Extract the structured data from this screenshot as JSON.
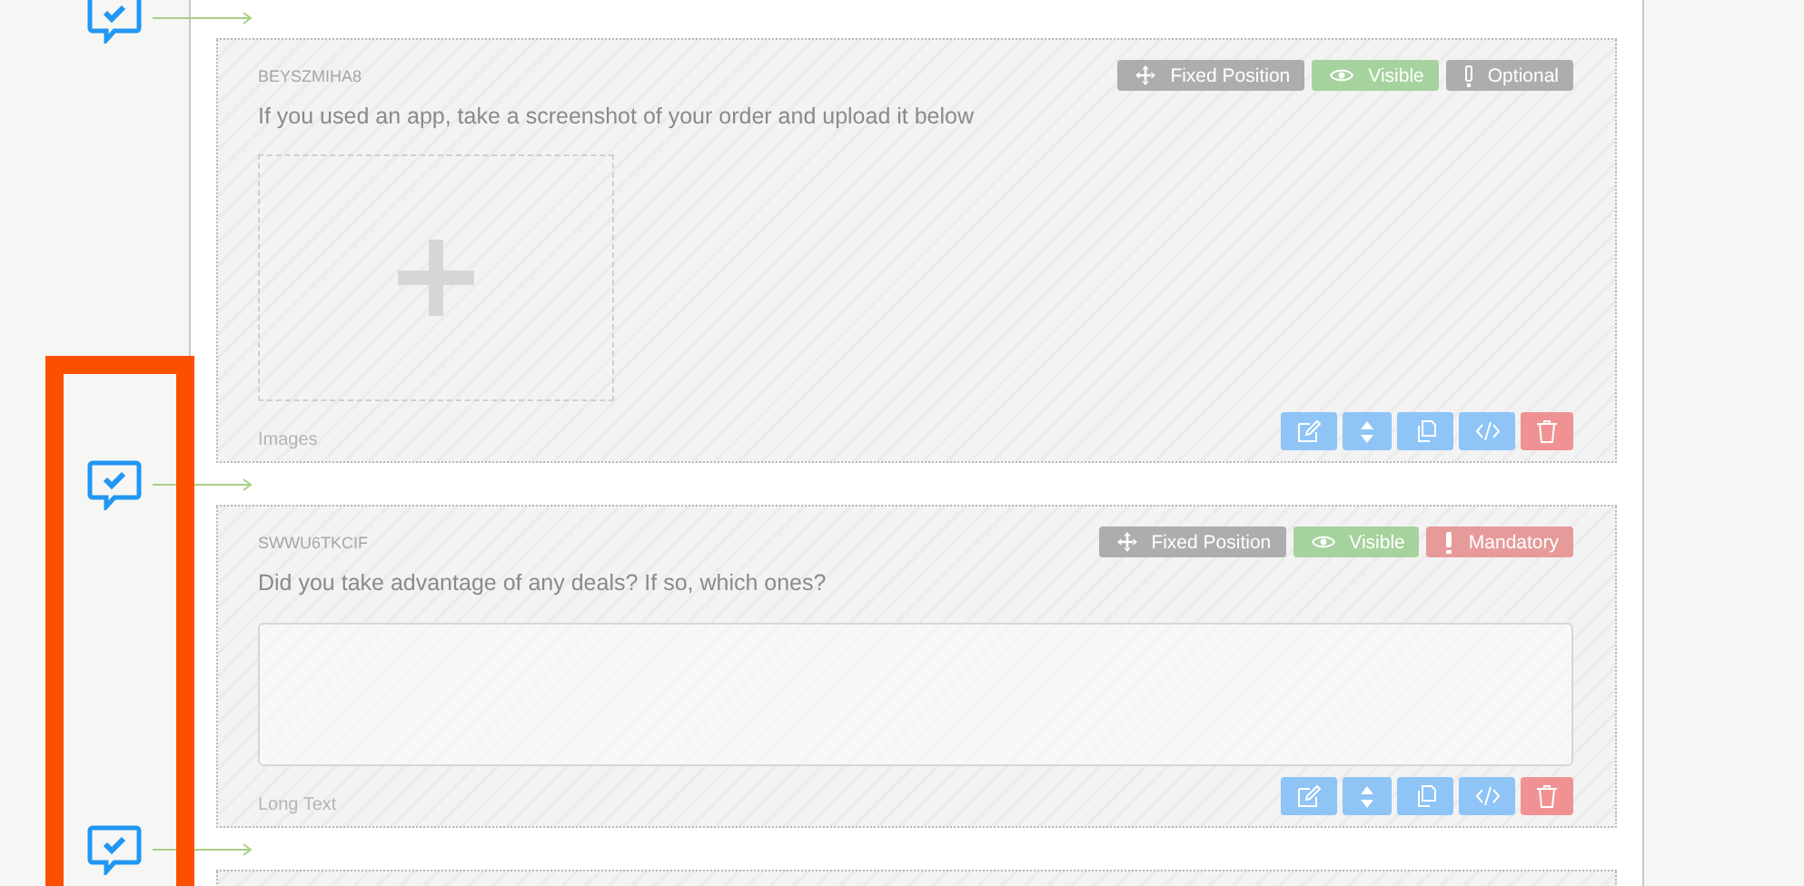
{
  "cards": [
    {
      "kind": "images",
      "id": "BEYSZMIHA8",
      "question": "If you used an app, take a screenshot of your order and upload it below",
      "badges": [
        {
          "kind": "position",
          "label": "Fixed Position"
        },
        {
          "kind": "visibility",
          "label": "Visible"
        },
        {
          "kind": "optional",
          "label": "Optional"
        }
      ],
      "type_label": "Images"
    },
    {
      "kind": "long_text",
      "id": "SWWU6TKCIF",
      "question": "Did you take advantage of any deals? If so, which ones?",
      "badges": [
        {
          "kind": "position",
          "label": "Fixed Position"
        },
        {
          "kind": "visibility",
          "label": "Visible"
        },
        {
          "kind": "mandatory",
          "label": "Mandatory"
        }
      ],
      "type_label": "Long Text"
    },
    {
      "kind": "partial"
    }
  ]
}
